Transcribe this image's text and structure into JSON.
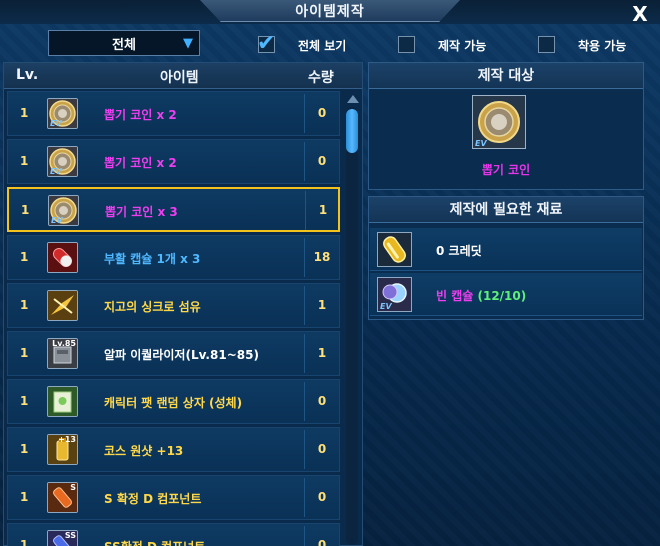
{
  "window": {
    "title": "아이템제작",
    "close_label": "X"
  },
  "filters": {
    "category_value": "전체",
    "show_all_label": "전체 보기",
    "show_all_checked": true,
    "craftable_label": "제작 가능",
    "craftable_checked": false,
    "wearable_label": "착용 가능",
    "wearable_checked": false
  },
  "list": {
    "headers": {
      "lv": "Lv.",
      "item": "아이템",
      "qty": "수량"
    },
    "items": [
      {
        "lv": "1",
        "name": "뽑기 코인 x 2",
        "qty": "0",
        "color": "#ee3ef0",
        "icon": "coin-icon",
        "selected": false
      },
      {
        "lv": "1",
        "name": "뽑기 코인 x 2",
        "qty": "0",
        "color": "#ee3ef0",
        "icon": "coin-icon",
        "selected": false
      },
      {
        "lv": "1",
        "name": "뽑기 코인 x 3",
        "qty": "1",
        "color": "#ee3ef0",
        "icon": "coin-icon",
        "selected": true
      },
      {
        "lv": "1",
        "name": "부활 캡슐 1개 x 3",
        "qty": "18",
        "color": "#4fb8ff",
        "icon": "revive-capsule-icon",
        "selected": false
      },
      {
        "lv": "1",
        "name": "지고의 싱크로 섬유",
        "qty": "1",
        "color": "#ffd84a",
        "icon": "synchro-fiber-icon",
        "selected": false
      },
      {
        "lv": "1",
        "name": "알파 이퀄라이저(Lv.81~85)",
        "qty": "1",
        "color": "#ffffff",
        "icon": "alpha-equalizer-icon",
        "badge": "Lv.85",
        "selected": false
      },
      {
        "lv": "1",
        "name": "캐릭터 팻 랜덤 상자 (성체)",
        "qty": "0",
        "color": "#ffd84a",
        "icon": "pet-box-icon",
        "selected": false
      },
      {
        "lv": "1",
        "name": "코스 원샷 +13",
        "qty": "0",
        "color": "#ffd84a",
        "icon": "costume-oneshot-icon",
        "badge": "+13",
        "selected": false
      },
      {
        "lv": "1",
        "name": "S 확정 D 컴포넌트",
        "qty": "0",
        "color": "#ffd84a",
        "icon": "component-s-icon",
        "badge": "S",
        "selected": false
      },
      {
        "lv": "1",
        "name": "SS확정 D 컴포넌트",
        "qty": "0",
        "color": "#ffd84a",
        "icon": "component-ss-icon",
        "badge": "SS",
        "selected": false
      }
    ]
  },
  "target": {
    "header": "제작 대상",
    "name": "뽑기 코인",
    "icon": "coin-icon"
  },
  "materials": {
    "header": "제작에 필요한 재료",
    "items": [
      {
        "name": "0 크레딧",
        "color": "#ffffff",
        "icon": "credit-icon"
      },
      {
        "name": "빈 캡슐 (12/10)",
        "color": "#ee3ef0",
        "name_suffix_color": "#5ff07a",
        "icon": "empty-capsule-icon"
      }
    ]
  },
  "colors": {
    "selected_border": "#f4c21c",
    "level_text": "#ffe07a",
    "accent_blue": "#4fb8ff"
  }
}
